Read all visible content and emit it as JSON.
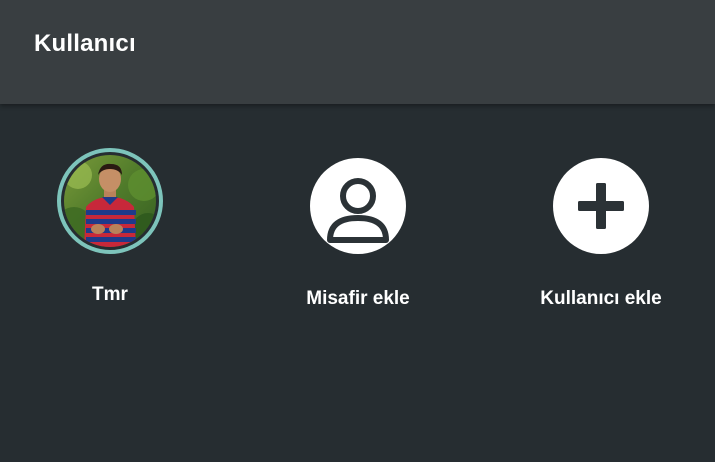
{
  "header": {
    "title": "Kullanıcı"
  },
  "users": [
    {
      "label": "Tmr",
      "icon": "user-photo-avatar"
    },
    {
      "label": "Misafir ekle",
      "icon": "person-icon"
    },
    {
      "label": "Kullanıcı ekle",
      "icon": "plus-icon"
    }
  ],
  "colors": {
    "background": "#262d31",
    "header": "#393e41",
    "accent_ring": "#7dc4bb",
    "icon_fg": "#2b3236",
    "text": "#ffffff"
  }
}
